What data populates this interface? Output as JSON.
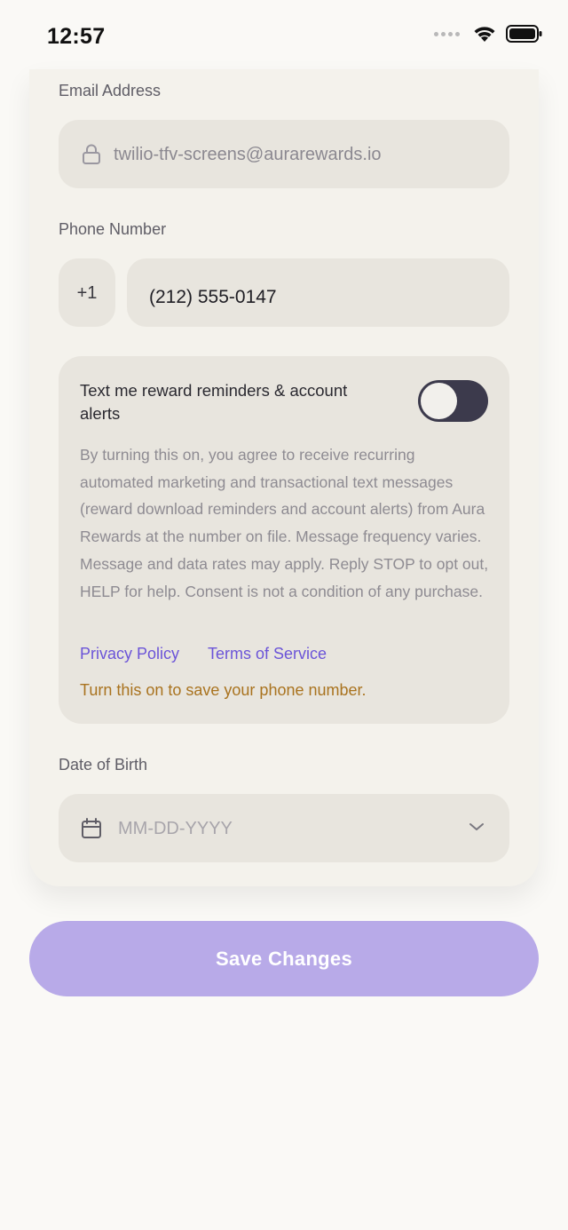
{
  "status_bar": {
    "time": "12:57"
  },
  "form": {
    "email": {
      "label": "Email Address",
      "value": "twilio-tfv-screens@aurarewards.io"
    },
    "phone": {
      "label": "Phone Number",
      "country_code": "+1",
      "value": "(212) 555-0147"
    },
    "sms_consent": {
      "title": "Text me reward reminders & account alerts",
      "enabled": false,
      "body": "By turning this on, you agree to receive recurring automated marketing and transactional text messages (reward download reminders and account alerts) from Aura Rewards at the number on file. Message frequency varies. Message and data rates may apply. Reply STOP to opt out, HELP for help. Consent is not a condition of any purchase.",
      "privacy_link": "Privacy Policy",
      "terms_link": "Terms of Service",
      "warning": "Turn this on to save your phone number."
    },
    "dob": {
      "label": "Date of Birth",
      "placeholder": "MM-DD-YYYY"
    }
  },
  "actions": {
    "save_label": "Save Changes"
  },
  "colors": {
    "accent": "#6b54d8",
    "button_disabled": "#b8aae8",
    "toggle_track": "#3c3a4c",
    "warning": "#a9731f"
  },
  "icons": [
    "lock-icon",
    "calendar-icon",
    "chevron-down-icon",
    "wifi-icon",
    "battery-icon",
    "signal-icon"
  ]
}
